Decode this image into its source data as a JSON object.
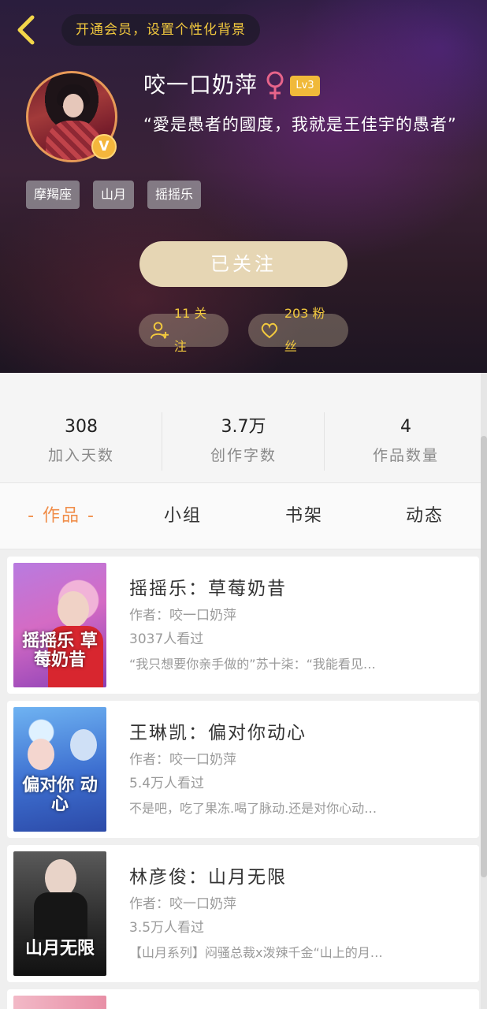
{
  "header": {
    "vip_banner": "开通会员，设置个性化背景"
  },
  "profile": {
    "username": "咬一口奶萍",
    "gender_symbol": "♀",
    "level": "Lv3",
    "verified_badge": "V",
    "bio": "“愛是愚者的國度，我就是王佳宇的愚者”",
    "tags": [
      "摩羯座",
      "山月",
      "摇摇乐"
    ],
    "follow_button": "已关注",
    "following": "11 关注",
    "fans": "203 粉丝"
  },
  "stats": [
    {
      "value": "308",
      "label": "加入天数"
    },
    {
      "value": "3.7万",
      "label": "创作字数"
    },
    {
      "value": "4",
      "label": "作品数量"
    }
  ],
  "tabs": [
    {
      "label": "- 作品 -"
    },
    {
      "label": "小组"
    },
    {
      "label": "书架"
    },
    {
      "label": "动态"
    }
  ],
  "works": [
    {
      "title": "摇摇乐：草莓奶昔",
      "author": "作者：咬一口奶萍",
      "views": "3037人看过",
      "desc": "“我只想要你亲手做的”苏十柒：“我能看见…",
      "cover_text": "摇摇乐 草莓奶昔"
    },
    {
      "title": "王琳凯：偏对你动心",
      "author": "作者：咬一口奶萍",
      "views": "5.4万人看过",
      "desc": "不是吧，吃了果冻.喝了脉动.还是对你心动…",
      "cover_text": "偏对你 动心"
    },
    {
      "title": "林彦俊：山月无限",
      "author": "作者：咬一口奶萍",
      "views": "3.5万人看过",
      "desc": "【山月系列】闷骚总裁x泼辣千金“山上的月…",
      "cover_text": "山月无限"
    }
  ],
  "colors": {
    "accent": "#f08e4a",
    "gold": "#f2c93e",
    "follow_button_bg": "#e6d6b4"
  }
}
